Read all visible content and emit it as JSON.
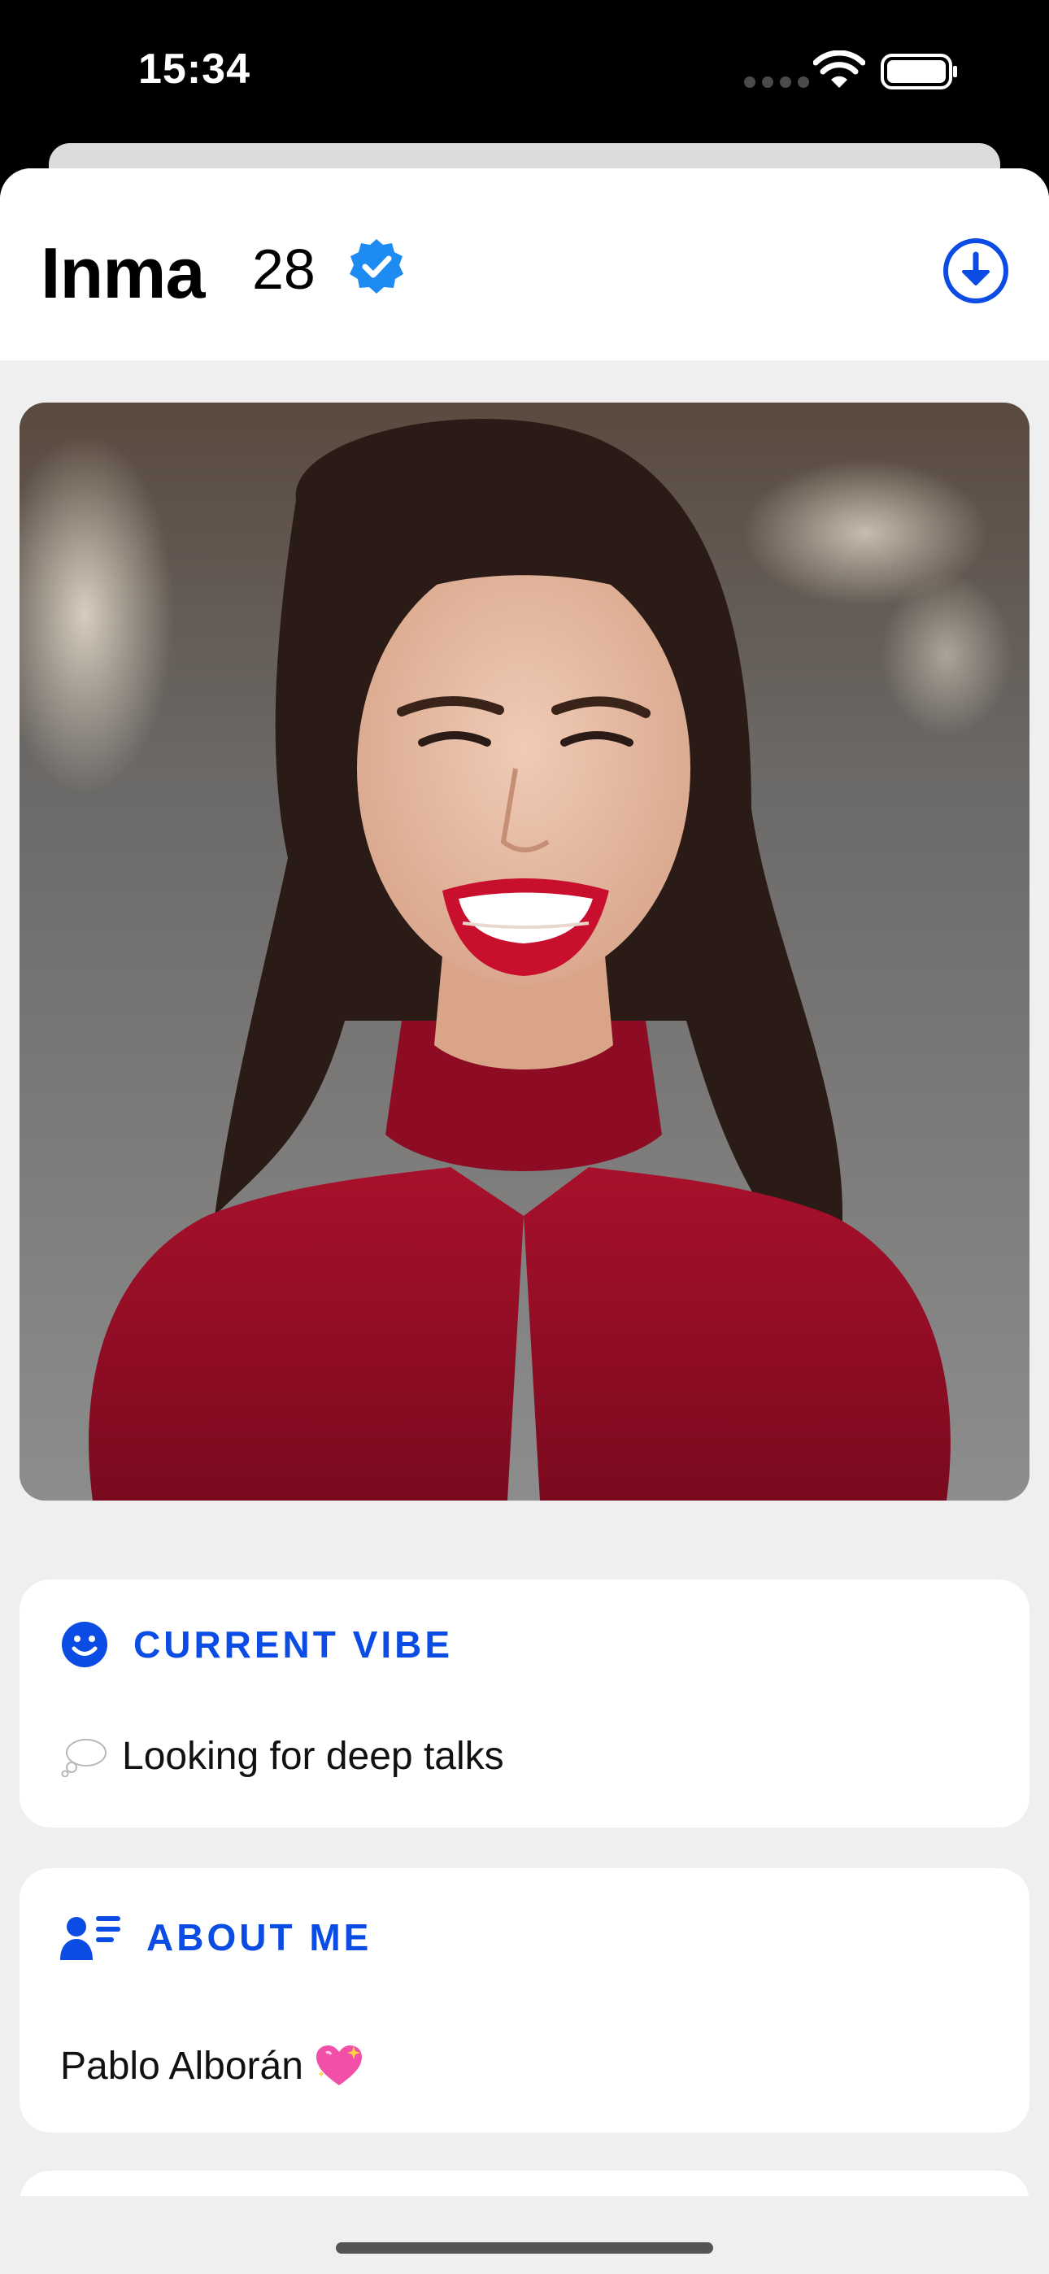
{
  "status_bar": {
    "time": "15:34",
    "icons": [
      "signal-dots-icon",
      "wifi-icon",
      "battery-icon"
    ]
  },
  "profile": {
    "name": "Inma",
    "age": "28",
    "verified_icon": "verified-badge-icon",
    "download_icon": "download-circle-icon"
  },
  "photo": {
    "icon": "profile-photo"
  },
  "sections": {
    "vibe": {
      "title": "CURRENT VIBE",
      "icon": "smiley-icon",
      "emoji": "thought-bubble-icon",
      "text": "Looking for deep talks"
    },
    "about": {
      "title": "ABOUT ME",
      "icon": "person-list-icon",
      "text": "Pablo Alborán",
      "emoji": "sparkling-heart-icon"
    }
  },
  "colors": {
    "accent": "#0b4ce4",
    "verified": "#1d8bf1",
    "background": "#efefef",
    "card": "#ffffff"
  }
}
